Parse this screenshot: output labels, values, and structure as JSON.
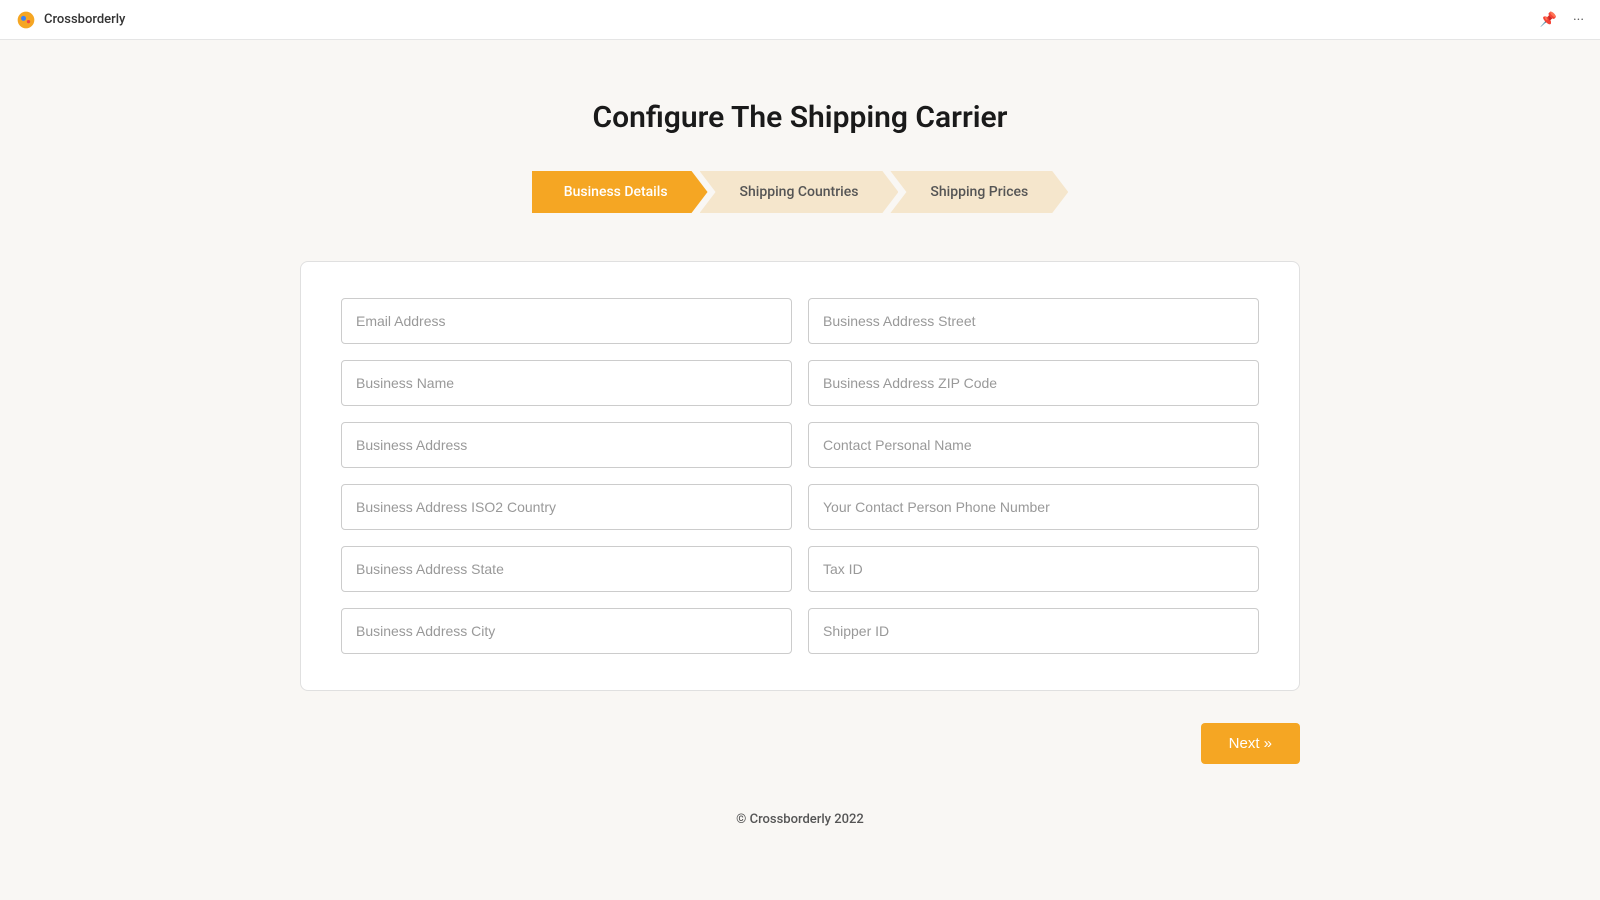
{
  "topbar": {
    "app_name": "Crossborderly",
    "pin_icon": "📌",
    "more_icon": "···"
  },
  "page": {
    "title": "Configure The Shipping Carrier"
  },
  "stepper": {
    "steps": [
      {
        "label": "Business Details",
        "active": true
      },
      {
        "label": "Shipping Countries",
        "active": false
      },
      {
        "label": "Shipping Prices",
        "active": false
      }
    ]
  },
  "form": {
    "fields_left": [
      {
        "placeholder": "Email Address",
        "name": "email-address"
      },
      {
        "placeholder": "Business Name",
        "name": "business-name"
      },
      {
        "placeholder": "Business Address",
        "name": "business-address"
      },
      {
        "placeholder": "Business Address ISO2 Country",
        "name": "business-address-iso2-country"
      },
      {
        "placeholder": "Business Address State",
        "name": "business-address-state"
      },
      {
        "placeholder": "Business Address City",
        "name": "business-address-city"
      }
    ],
    "fields_right": [
      {
        "placeholder": "Business Address Street",
        "name": "business-address-street"
      },
      {
        "placeholder": "Business Address ZIP Code",
        "name": "business-address-zip"
      },
      {
        "placeholder": "Contact Personal Name",
        "name": "contact-personal-name"
      },
      {
        "placeholder": "Your Contact Person Phone Number",
        "name": "contact-phone-number"
      },
      {
        "placeholder": "Tax ID",
        "name": "tax-id"
      },
      {
        "placeholder": "Shipper ID",
        "name": "shipper-id"
      }
    ]
  },
  "buttons": {
    "next_label": "Next »"
  },
  "footer": {
    "text": "© Crossborderly 2022"
  }
}
